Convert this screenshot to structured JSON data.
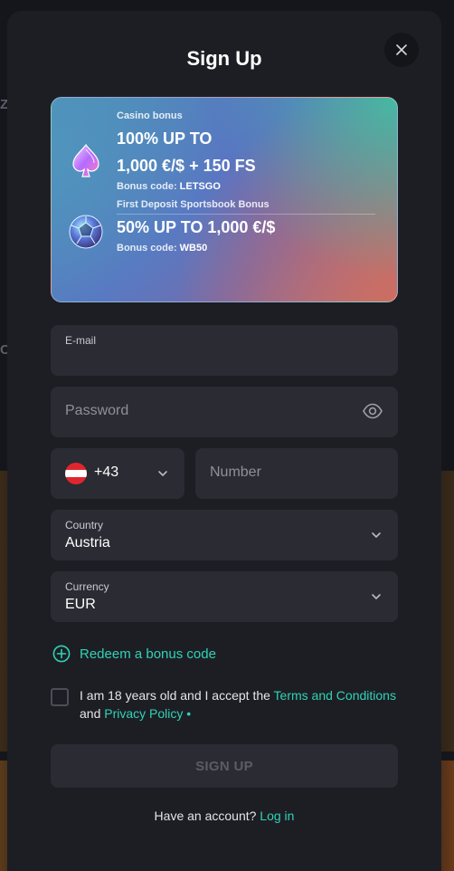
{
  "modal": {
    "title": "Sign Up"
  },
  "bonus": {
    "casino_label": "Casino bonus",
    "casino_line1": "100% UP TO",
    "casino_line2": "1,000 €/$ + 150 FS",
    "casino_code_prefix": "Bonus code: ",
    "casino_code": "LETSGO",
    "sports_label": "First Deposit Sportsbook Bonus",
    "sports_amount": "50% UP TO 1,000 €/$",
    "sports_code_prefix": "Bonus code: ",
    "sports_code": "WB50"
  },
  "form": {
    "email_label": "E-mail",
    "password_placeholder": "Password",
    "phone_code": "+43",
    "number_placeholder": "Number",
    "country_label": "Country",
    "country_value": "Austria",
    "currency_label": "Currency",
    "currency_value": "EUR",
    "redeem_label": "Redeem a bonus code"
  },
  "terms": {
    "prefix": "I am 18 years old and I accept the ",
    "terms_link": "Terms and Conditions",
    "middle": " and ",
    "privacy_link": "Privacy Policy",
    "required_mark": " •"
  },
  "actions": {
    "signup_label": "SIGN UP",
    "have_account": "Have an account? ",
    "login_label": "Log in"
  },
  "colors": {
    "accent": "#2fd3b5",
    "modal_bg": "#1d1e24",
    "field_bg": "#2a2b33",
    "flag_red": "#e0262d"
  }
}
